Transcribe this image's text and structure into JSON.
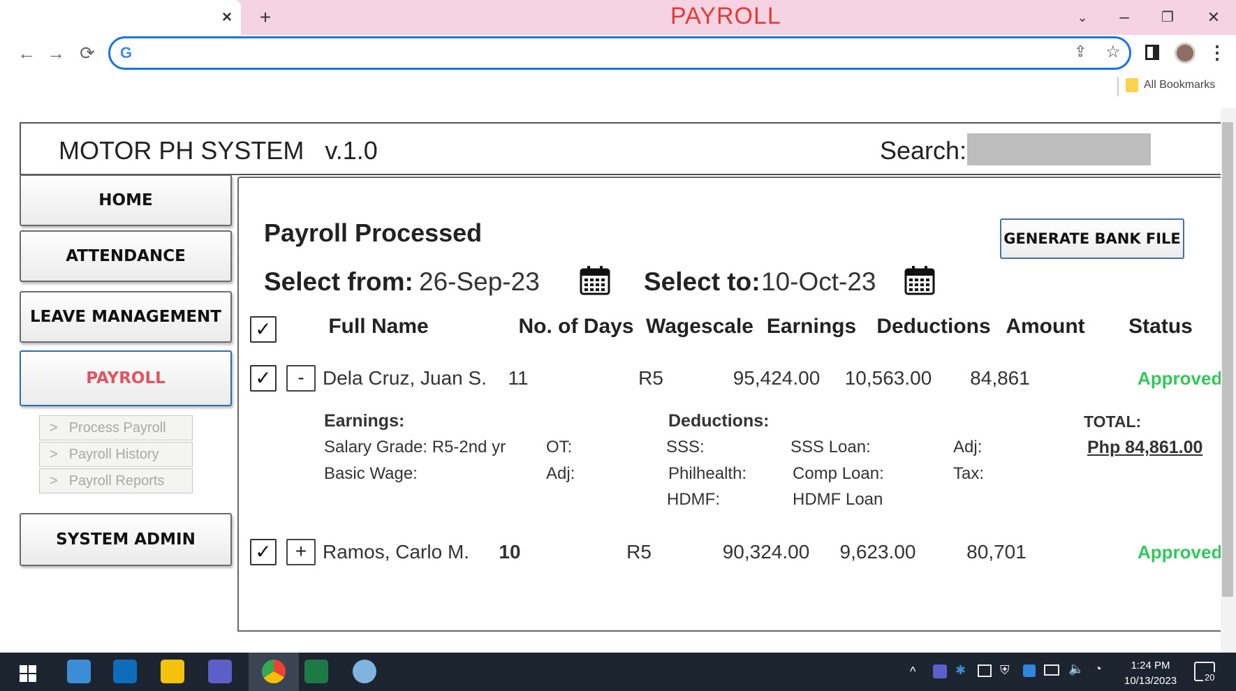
{
  "browser": {
    "window_title": "PAYROLL",
    "tab_close": "×",
    "new_tab": "+",
    "bookmarks_label": "All Bookmarks"
  },
  "app": {
    "title": "MOTOR PH SYSTEM   v.1.0",
    "search_label": "Search:",
    "search_value": ""
  },
  "sidebar": {
    "items": [
      {
        "label": "HOME",
        "active": false
      },
      {
        "label": "ATTENDANCE",
        "active": false
      },
      {
        "label": "LEAVE MANAGEMENT",
        "active": false
      },
      {
        "label": "PAYROLL",
        "active": true
      },
      {
        "label": "SYSTEM ADMIN",
        "active": false
      }
    ],
    "submenu": [
      {
        "label": "Process Payroll"
      },
      {
        "label": "Payroll History"
      },
      {
        "label": "Payroll Reports"
      }
    ],
    "submenu_chevron": ">"
  },
  "panel": {
    "title": "Payroll Processed",
    "generate_button": "GENERATE BANK FILE",
    "select_from_label": "Select from:",
    "select_from_value": "26-Sep-23",
    "select_to_label": "Select to:",
    "select_to_value": "10-Oct-23"
  },
  "table": {
    "headers": [
      "Full Name",
      "No. of Days",
      "Wagescale",
      "Earnings",
      "Deductions",
      "Amount",
      "Status"
    ],
    "rows": [
      {
        "toggle": "-",
        "name": "Dela Cruz, Juan S.",
        "days": "11",
        "wagescale": "R5",
        "earnings": "95,424.00",
        "deductions": "10,563.00",
        "amount": "84,861",
        "status": "Approved"
      },
      {
        "toggle": "+",
        "name": "Ramos, Carlo M.",
        "days": "10",
        "wagescale": "R5",
        "earnings": "90,324.00",
        "deductions": "9,623.00",
        "amount": "80,701",
        "status": "Approved"
      }
    ],
    "check_mark": "✓"
  },
  "details": {
    "earnings_heading": "Earnings:",
    "deductions_heading": "Deductions:",
    "total_heading": "TOTAL:",
    "total_value": "Php 84,861.00",
    "salary_grade": "Salary Grade: R5-2nd yr",
    "basic_wage": "Basic Wage:",
    "ot": "OT:",
    "adj1": "Adj:",
    "sss": "SSS:",
    "philhealth": "Philhealth:",
    "hdmf": "HDMF:",
    "sss_loan": "SSS Loan:",
    "comp_loan": "Comp Loan:",
    "hdmf_loan": "HDMF Loan",
    "adj2": "Adj:",
    "tax": "Tax:"
  },
  "taskbar": {
    "time": "1:24 PM",
    "date": "10/13/2023",
    "notifications": "20"
  },
  "colors": {
    "title_bar": "#f6d3e3",
    "title_text": "#e53935",
    "active_nav": "#e05560",
    "status_approved": "#34c759",
    "omnibox_border": "#1a73e8"
  }
}
